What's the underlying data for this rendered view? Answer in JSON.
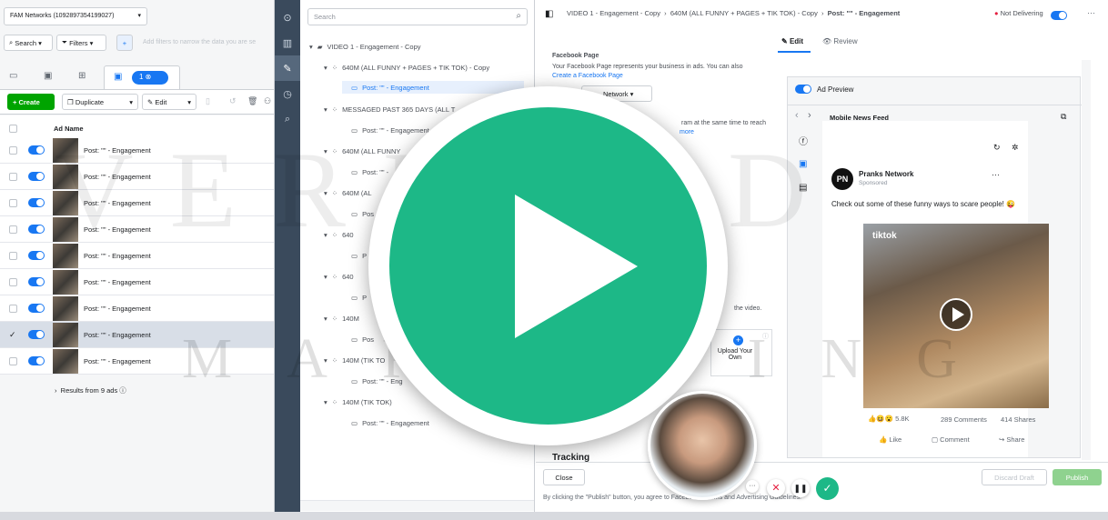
{
  "account": {
    "name": "FAM Networks (1092897354199027)"
  },
  "toolbar": {
    "search_label": "Search",
    "filters_label": "Filters",
    "filter_placeholder": "Add filters to narrow the data you are se",
    "selected_count": "1",
    "create_label": "+ Create",
    "duplicate_label": "Duplicate",
    "edit_label": "Edit"
  },
  "table": {
    "header": "Ad Name",
    "rows": [
      {
        "name": "Post: \"\" - Engagement"
      },
      {
        "name": "Post: \"\" - Engagement"
      },
      {
        "name": "Post: \"\" - Engagement"
      },
      {
        "name": "Post: \"\" - Engagement"
      },
      {
        "name": "Post: \"\" - Engagement"
      },
      {
        "name": "Post: \"\" - Engagement"
      },
      {
        "name": "Post: \"\" - Engagement"
      },
      {
        "name": "Post: \"\" - Engagement"
      },
      {
        "name": "Post: \"\" - Engagement"
      }
    ],
    "results": "Results from 9 ads"
  },
  "tree": {
    "search_placeholder": "Search",
    "campaign": "VIDEO 1 - Engagement - Copy",
    "adset1": "640M (ALL FUNNY + PAGES + TIK TOK) - Copy",
    "ad1": "Post: \"\" - Engagement",
    "adset2": "MESSAGED PAST 365 DAYS (ALL T",
    "ad2": "Post: \"\" - Engagement",
    "adset3": "640M (ALL FUNNY",
    "ad3": "Post: \"\" -",
    "adset4": "640M (AL",
    "ad4": "Pos",
    "adset5": "640",
    "ad5": "P",
    "adset6": "640",
    "ad6": "P",
    "adset7": "140M",
    "ad7": "Pos",
    "adset8": "140M (TIK TO",
    "ad8": "Post: \"\" - Eng",
    "adset9": "140M (TIK TOK)",
    "ad9": "Post: \"\" - Engagement"
  },
  "editor": {
    "breadcrumb1": "VIDEO 1 - Engagement - Copy",
    "breadcrumb2": "640M (ALL FUNNY + PAGES + TIK TOK) - Copy",
    "breadcrumb3": "Post: \"\" - Engagement",
    "status": "Not Delivering",
    "tab_edit": "Edit",
    "tab_review": "Review",
    "fb_page_heading": "Facebook Page",
    "fb_page_desc": "Your Facebook Page represents your business in ads. You can also",
    "create_page_link": "Create a Facebook Page",
    "network_select": "Network",
    "ig_text": "ram at the same time to reach",
    "ig_more": "more",
    "video_text": "the video.",
    "upload_label": "Upload Your Own",
    "tracking": "Tracking",
    "close_label": "Close",
    "terms": "By clicking the \"Publish\" button, you agree to Facebook's Terms and Advertising Guidelines.",
    "discard_label": "Discard Draft",
    "publish_label": "Publish"
  },
  "preview": {
    "toggle_label": "Ad Preview",
    "placement": "Mobile News Feed",
    "page_name": "Pranks Network",
    "page_initials": "PN",
    "sponsored": "Sponsored",
    "post_text": "Check out some of these funny ways to scare people! 😜",
    "video_label": "tiktok",
    "reactions": "5.8K",
    "comments": "289 Comments",
    "shares": "414 Shares",
    "like_label": "Like",
    "comment_label": "Comment",
    "share_label": "Share"
  },
  "watermark": {
    "line1": "VERIFIED",
    "line2": "MARKETING"
  },
  "colors": {
    "accent": "#1877f2",
    "play_green": "#1db887",
    "create_green": "#00a400",
    "rail": "#3a4a5c"
  }
}
